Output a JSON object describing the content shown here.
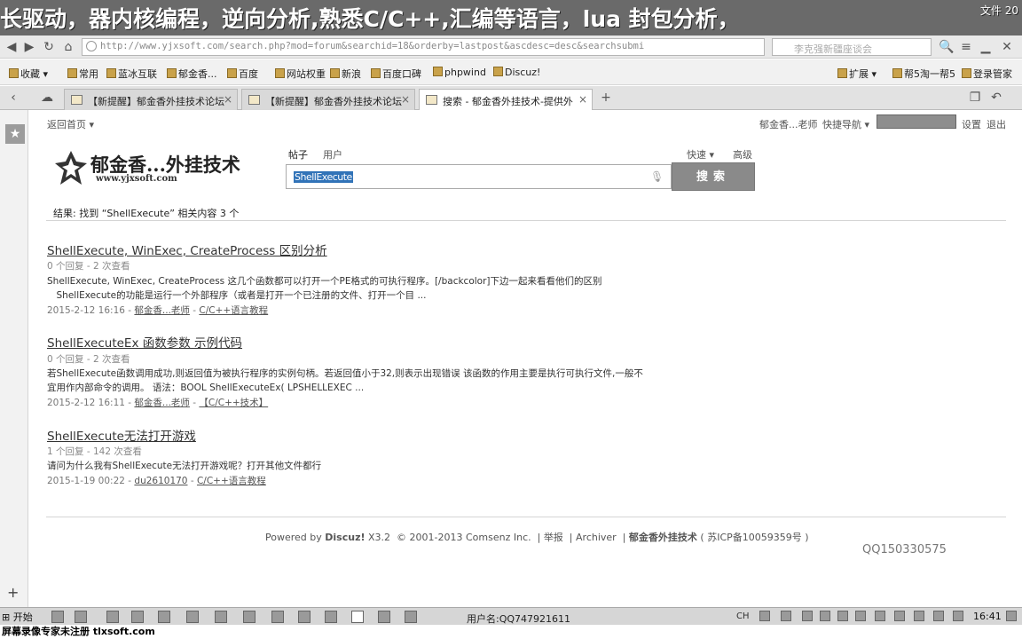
{
  "title_overlay": "长驱动，器内核编程，逆向分析,熟悉C/C++,汇编等语言，lua 封包分析，",
  "title_right": "文件 20",
  "browser": {
    "url": "http://www.yjxsoft.com/search.php?mod=forum&searchid=18&orderby=lastpost&ascdesc=desc&searchsubmi",
    "search_placeholder": "李克强新疆座谈会",
    "bookmarks": [
      "收藏",
      "常用",
      "蓝冰互联",
      "郁金香...",
      "百度",
      "网站权重",
      "新浪",
      "百度口碑",
      "phpwind",
      "Discuz!"
    ],
    "bookmarks_right": [
      "扩展",
      "帮5淘一帮5",
      "登录管家"
    ],
    "tabs": [
      {
        "label": "【新提醒】郁金香外挂技术论坛",
        "active": false
      },
      {
        "label": "【新提醒】郁金香外挂技术论坛",
        "active": false
      },
      {
        "label": "搜索 - 郁金香外挂技术-提供外",
        "active": true
      }
    ]
  },
  "page": {
    "back_home": "返回首页",
    "user_links": {
      "user": "郁金香...老师",
      "quick_nav": "快捷导航",
      "settings": "设置",
      "logout": "退出"
    },
    "logo_text": "郁金香...外挂技术",
    "logo_url": "www.yjxsoft.com",
    "search_tabs": {
      "posts": "帖子",
      "users": "用户"
    },
    "quick": "快速",
    "advanced": "高级",
    "query": "ShellExecute",
    "search_button": "搜索",
    "result_summary": "结果: 找到 “ShellExecute” 相关内容 3 个",
    "results": [
      {
        "title": "ShellExecute, WinExec, CreateProcess 区别分析",
        "meta": "0 个回复 - 2 次查看",
        "text1": "ShellExecute, WinExec, CreateProcess 这几个函数都可以打开一个PE格式的可执行程序。[/backcolor]下边一起来看看他们的区别",
        "text2": "　ShellExecute的功能是运行一个外部程序（或者是打开一个已注册的文件、打开一个目 ...",
        "date": "2015-2-12 16:16",
        "author": "郁金香...老师",
        "forum": "C/C++语言教程"
      },
      {
        "title": "ShellExecuteEx 函数参数 示例代码",
        "meta": "0 个回复 - 2 次查看",
        "text1": "若ShellExecute函数调用成功,则返回值为被执行程序的实例句柄。若返回值小于32,则表示出现错误 该函数的作用主要是执行可执行文件,一般不",
        "text2": "宜用作内部命令的调用。 语法：BOOL ShellExecuteEx( LPSHELLEXEC ...",
        "date": "2015-2-12 16:11",
        "author": "郁金香...老师",
        "forum": "【C/C++技术】"
      },
      {
        "title": "ShellExecute无法打开游戏",
        "meta": "1 个回复 - 142 次查看",
        "text1": "请问为什么我有ShellExecute无法打开游戏呢？打开其他文件都行",
        "text2": "",
        "date": "2015-1-19 00:22",
        "author": "du2610170",
        "forum": "C/C++语言教程"
      }
    ],
    "footer": {
      "powered": "Powered by",
      "brand": "Discuz!",
      "version": "X3.2",
      "copyright": "© 2001-2013 Comsenz Inc.",
      "report": "举报",
      "archiver": "Archiver",
      "site": "郁金香外挂技术",
      "icp": "( 苏ICP备10059359号 )"
    },
    "qq": "QQ150330575"
  },
  "taskbar": {
    "start": "开始",
    "user": "用户名:QQ747921611",
    "clock": "16:41",
    "ime": "CH"
  },
  "watermark": "屏幕录像专家未注册 tlxsoft.com"
}
